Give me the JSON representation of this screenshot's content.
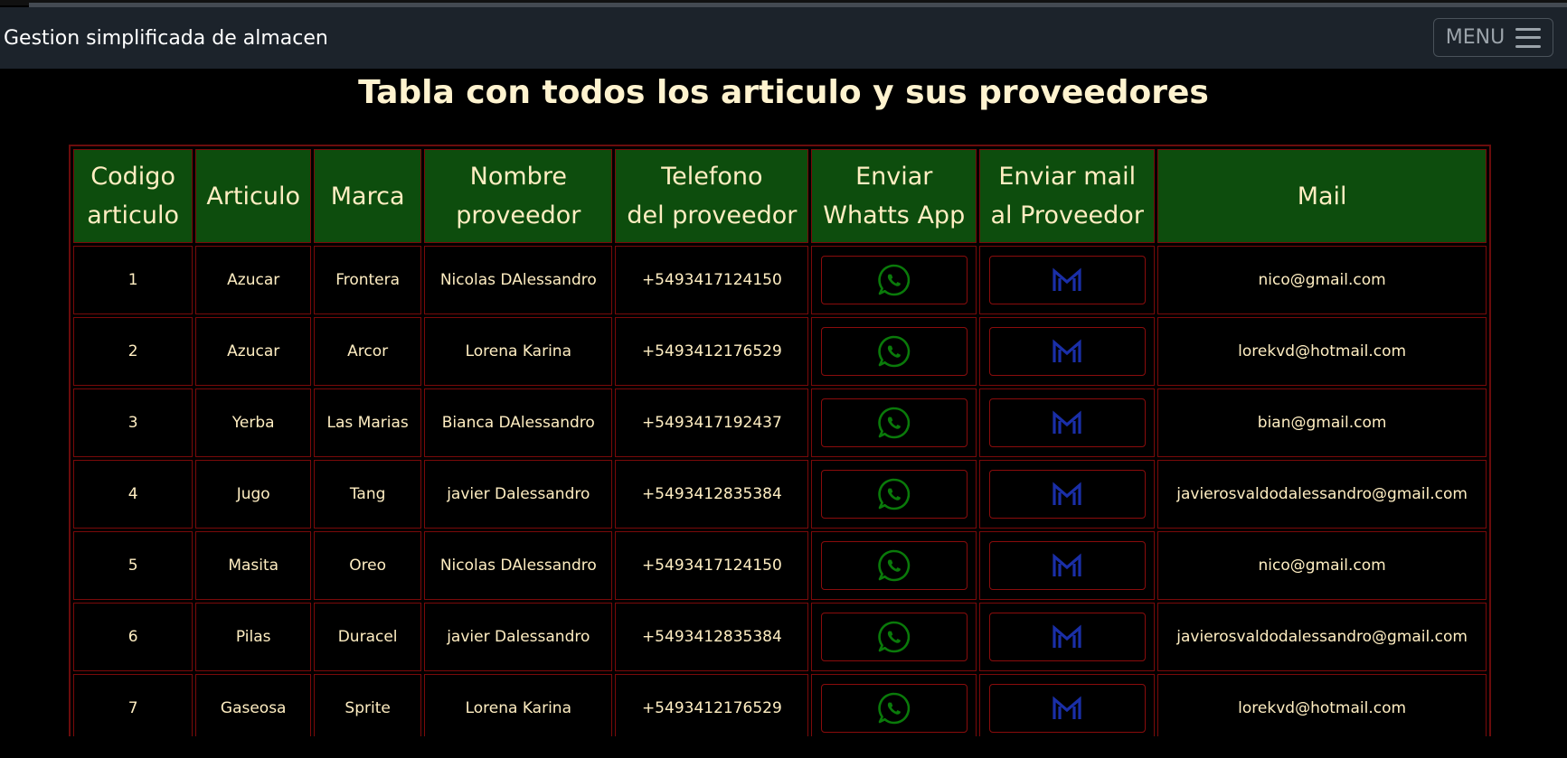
{
  "navbar": {
    "brand": "Gestion simplificada de almacen",
    "menu_label": "MENU"
  },
  "page": {
    "title": "Tabla con todos los articulo y sus proveedores"
  },
  "table": {
    "headers": {
      "codigo": [
        "Codigo",
        "articulo"
      ],
      "articulo": "Articulo",
      "marca": "Marca",
      "nombre": [
        "Nombre",
        "proveedor"
      ],
      "telefono": [
        "Telefono",
        "del proveedor"
      ],
      "whatsapp": [
        "Enviar",
        "Whatts App"
      ],
      "enviar_mail": [
        "Enviar mail",
        "al Proveedor"
      ],
      "mail": "Mail"
    },
    "rows": [
      {
        "codigo": "1",
        "articulo": "Azucar",
        "marca": "Frontera",
        "proveedor": "Nicolas DAlessandro",
        "telefono": "+5493417124150",
        "mail": "nico@gmail.com"
      },
      {
        "codigo": "2",
        "articulo": "Azucar",
        "marca": "Arcor",
        "proveedor": "Lorena Karina",
        "telefono": "+5493412176529",
        "mail": "lorekvd@hotmail.com"
      },
      {
        "codigo": "3",
        "articulo": "Yerba",
        "marca": "Las Marias",
        "proveedor": "Bianca DAlessandro",
        "telefono": "+5493417192437",
        "mail": "bian@gmail.com"
      },
      {
        "codigo": "4",
        "articulo": "Jugo",
        "marca": "Tang",
        "proveedor": "javier Dalessandro",
        "telefono": "+5493412835384",
        "mail": "javierosvaldodalessandro@gmail.com"
      },
      {
        "codigo": "5",
        "articulo": "Masita",
        "marca": "Oreo",
        "proveedor": "Nicolas DAlessandro",
        "telefono": "+5493417124150",
        "mail": "nico@gmail.com"
      },
      {
        "codigo": "6",
        "articulo": "Pilas",
        "marca": "Duracel",
        "proveedor": "javier Dalessandro",
        "telefono": "+5493412835384",
        "mail": "javierosvaldodalessandro@gmail.com"
      },
      {
        "codigo": "7",
        "articulo": "Gaseosa",
        "marca": "Sprite",
        "proveedor": "Lorena Karina",
        "telefono": "+5493412176529",
        "mail": "lorekvd@hotmail.com"
      }
    ]
  },
  "icons": {
    "whatsapp": "whatsapp-icon",
    "mail": "gmail-icon",
    "menu": "hamburger-icon"
  },
  "colors": {
    "background": "#000000",
    "navbar": "#1c232b",
    "header_bg": "#0d4d0d",
    "text": "#ffeec2",
    "border": "#7a0a0a",
    "whatsapp_icon": "#0a7a0a",
    "mail_icon": "#1a2fa8"
  }
}
